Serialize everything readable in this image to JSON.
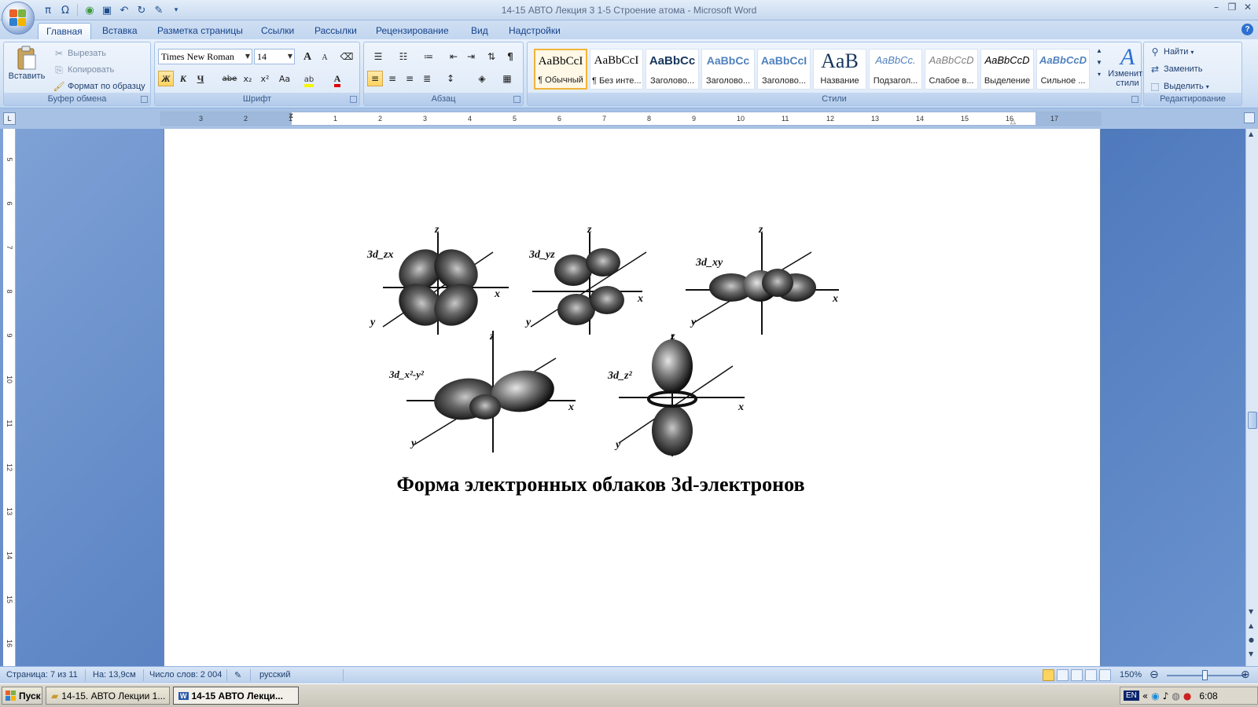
{
  "window": {
    "title": "14-15   АВТО Лекция 3  1-5  Строение  атома - Microsoft Word"
  },
  "quick_access": {
    "icons": [
      "pi-icon",
      "omega-icon",
      "globe-icon",
      "save-icon",
      "undo-icon",
      "redo-icon",
      "spellcheck-icon",
      "customize-icon"
    ]
  },
  "tabs": [
    "Главная",
    "Вставка",
    "Разметка страницы",
    "Ссылки",
    "Рассылки",
    "Рецензирование",
    "Вид",
    "Надстройки"
  ],
  "ribbon": {
    "clipboard": {
      "label": "Буфер обмена",
      "paste": "Вставить",
      "cut": "Вырезать",
      "copy": "Копировать",
      "format_painter": "Формат по образцу"
    },
    "font": {
      "label": "Шрифт",
      "family": "Times New Roman",
      "size": "14",
      "bold": "Ж",
      "italic": "К",
      "underline": "Ч",
      "strike": "abe",
      "subscript": "x₂",
      "superscript": "x²",
      "case": "Aa",
      "grow": "A",
      "shrink": "A"
    },
    "paragraph": {
      "label": "Абзац",
      "pilcrow": "¶"
    },
    "styles": {
      "label": "Стили",
      "items": [
        {
          "sample": "AaBbCcI",
          "name": "¶ Обычный"
        },
        {
          "sample": "AaBbCcI",
          "name": "¶ Без инте..."
        },
        {
          "sample": "AaBbCc",
          "name": "Заголово..."
        },
        {
          "sample": "AaBbCc",
          "name": "Заголово..."
        },
        {
          "sample": "AaBbCcI",
          "name": "Заголово..."
        },
        {
          "sample": "AaB",
          "name": "Название"
        },
        {
          "sample": "AaBbCc.",
          "name": "Подзагол..."
        },
        {
          "sample": "AaBbCcD",
          "name": "Слабое в..."
        },
        {
          "sample": "AaBbCcD",
          "name": "Выделение"
        },
        {
          "sample": "AaBbCcD",
          "name": "Сильное ..."
        }
      ],
      "change_styles_1": "Изменить",
      "change_styles_2": "стили"
    },
    "editing": {
      "label": "Редактирование",
      "find": "Найти",
      "replace": "Заменить",
      "select": "Выделить"
    }
  },
  "ruler": {
    "h_ticks": [
      "3",
      "2",
      "1",
      "1",
      "2",
      "3",
      "4",
      "5",
      "6",
      "7",
      "8",
      "9",
      "10",
      "11",
      "12",
      "13",
      "14",
      "15",
      "16",
      "17"
    ],
    "v_ticks": [
      "5",
      "6",
      "7",
      "8",
      "9",
      "10",
      "11",
      "12",
      "13",
      "14",
      "15",
      "16"
    ]
  },
  "document": {
    "orbital_labels": [
      "3d_zx",
      "3d_yz",
      "3d_xy",
      "3d_x²-y²",
      "3d_z²"
    ],
    "axis_x": "x",
    "axis_y": "y",
    "axis_z": "z",
    "caption": "Форма электронных облаков 3d-электронов"
  },
  "status": {
    "page": "Страница: 7 из 11",
    "position": "На: 13,9см",
    "words": "Число слов: 2 004",
    "language": "русский",
    "zoom": "150%"
  },
  "taskbar": {
    "start": "Пуск",
    "task1": "14-15.  АВТО  Лекции  1...",
    "task2": "14-15   АВТО  Лекци...",
    "lang": "EN",
    "time": "6:08"
  },
  "colors": {
    "ribbon_bg": "#dce8f7",
    "workspace": "#5e86c5",
    "accent": "#15428b"
  }
}
